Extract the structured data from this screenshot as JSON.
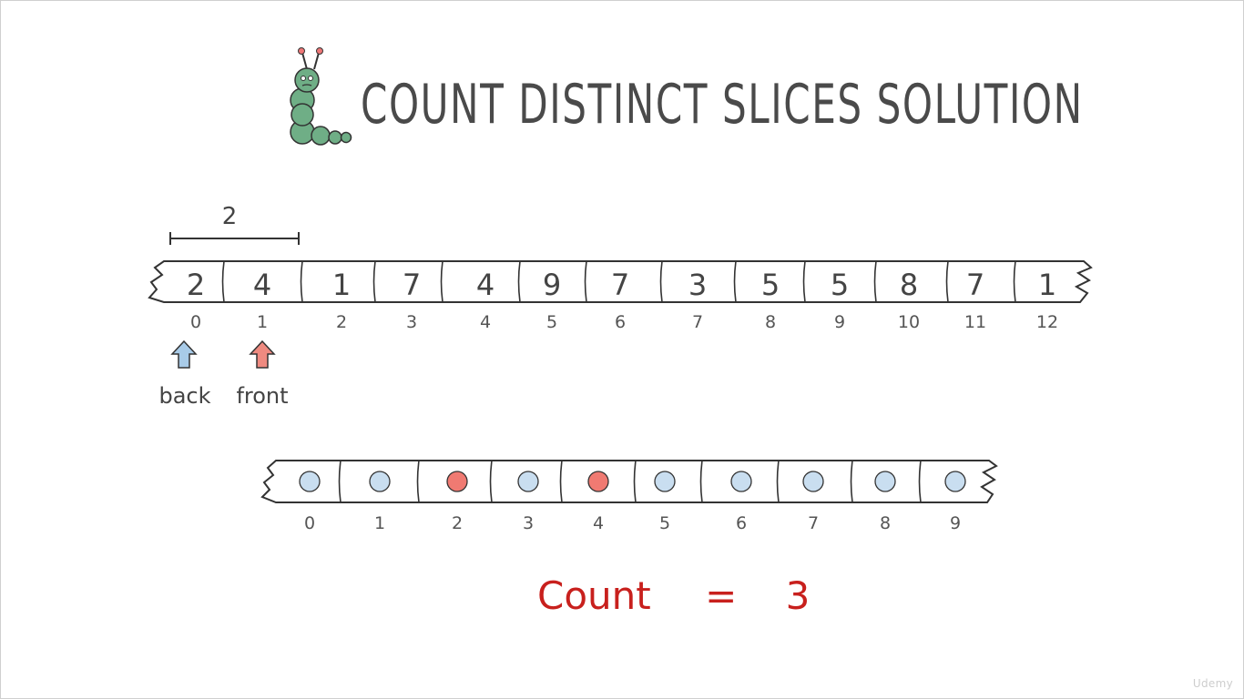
{
  "title": "Count Distinct Slices Solution",
  "slice_label": "2",
  "array": {
    "values": [
      "2",
      "4",
      "1",
      "7",
      "4",
      "9",
      "7",
      "3",
      "5",
      "5",
      "8",
      "7",
      "1"
    ],
    "indices": [
      "0",
      "1",
      "2",
      "3",
      "4",
      "5",
      "6",
      "7",
      "8",
      "9",
      "10",
      "11",
      "12"
    ]
  },
  "pointers": {
    "back": {
      "label": "back",
      "index": 0,
      "color": "#a8cbe8"
    },
    "front": {
      "label": "front",
      "index": 1,
      "color": "#ef8a80"
    }
  },
  "seen": {
    "indices": [
      "0",
      "1",
      "2",
      "3",
      "4",
      "5",
      "6",
      "7",
      "8",
      "9"
    ],
    "marked": [
      false,
      false,
      true,
      false,
      true,
      false,
      false,
      false,
      false,
      false
    ],
    "colors": {
      "unmarked": "#c9def0",
      "marked": "#f07a72"
    }
  },
  "count": {
    "label": "Count",
    "equals": "=",
    "value": "3"
  },
  "watermark": "Udemy"
}
